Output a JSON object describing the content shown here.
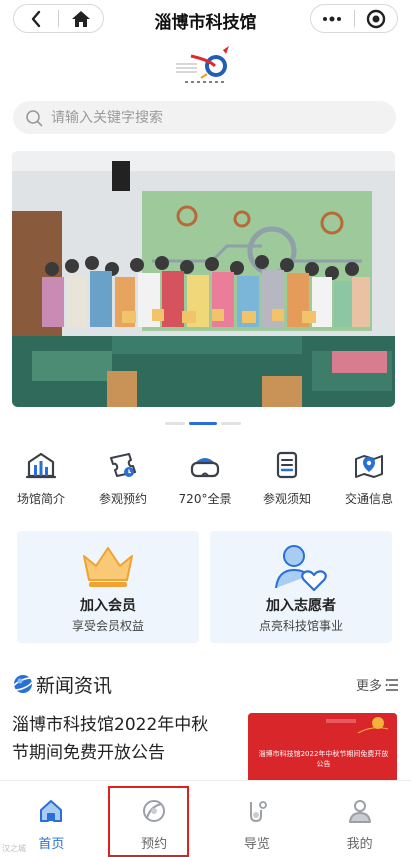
{
  "app": {
    "title": "淄博市科技馆"
  },
  "search": {
    "placeholder": "请输入关键字搜索"
  },
  "banner": {
    "slide_count": 3,
    "active_slide": 2
  },
  "quick_links": [
    {
      "label": "场馆简介",
      "icon": "building-chart-icon"
    },
    {
      "label": "参观预约",
      "icon": "ticket-icon"
    },
    {
      "label": "720°全景",
      "icon": "vr-headset-icon"
    },
    {
      "label": "参观须知",
      "icon": "notice-document-icon"
    },
    {
      "label": "交通信息",
      "icon": "map-location-icon"
    }
  ],
  "cards": [
    {
      "title": "加入会员",
      "subtitle": "享受会员权益",
      "icon": "crown-icon"
    },
    {
      "title": "加入志愿者",
      "subtitle": "点亮科技馆事业",
      "icon": "volunteer-heart-icon"
    }
  ],
  "news": {
    "heading": "新闻资讯",
    "more_label": "更多",
    "items": [
      {
        "title": "淄博市科技馆2022年中秋节期间免费开放公告",
        "thumb_text": "淄博市科技馆2022年中秋节期间免费开放公告"
      }
    ]
  },
  "tabbar": [
    {
      "label": "首页",
      "icon": "home-icon",
      "active": true
    },
    {
      "label": "预约",
      "icon": "booking-icon",
      "active": false
    },
    {
      "label": "导览",
      "icon": "guide-icon",
      "active": false
    },
    {
      "label": "我的",
      "icon": "profile-icon",
      "active": false
    }
  ],
  "watermark": "汉之城",
  "colors": {
    "accent": "#2a6fd6",
    "highlight_box": "#e0201f",
    "card_bg": "#eef5fd",
    "news_thumb": "#d9262a"
  }
}
